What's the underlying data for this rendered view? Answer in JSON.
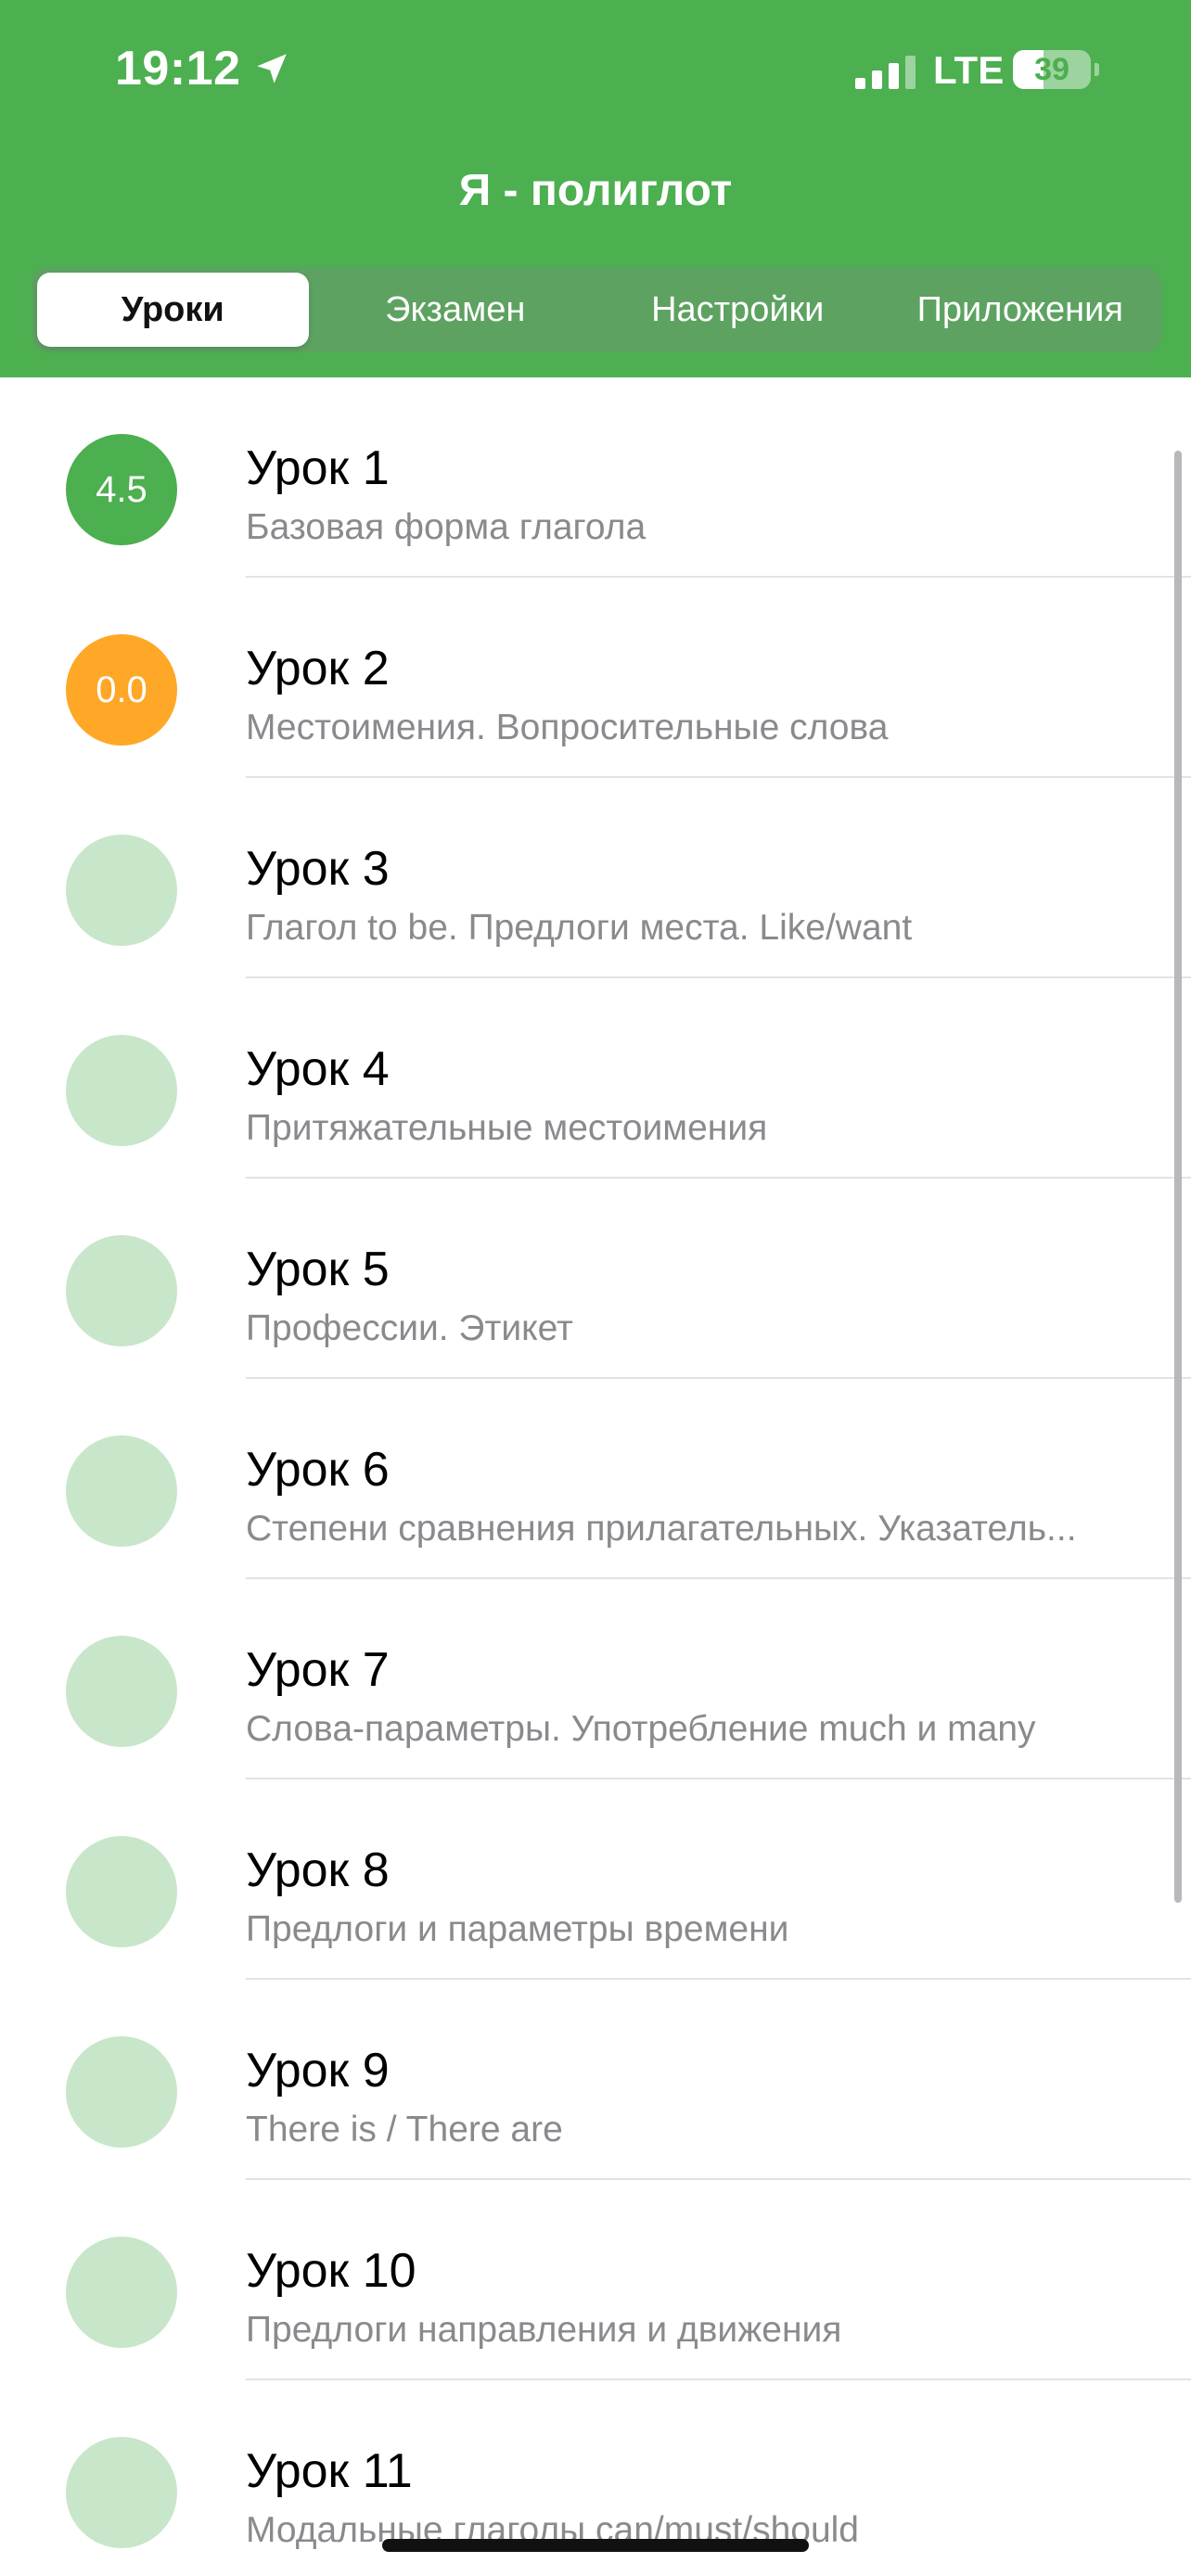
{
  "status_bar": {
    "time": "19:12",
    "network": "LTE",
    "battery_level": "39",
    "battery_fraction": 0.39,
    "signal_bars_active": 3
  },
  "app": {
    "title": "Я - полиглот"
  },
  "colors": {
    "header": "#4caf50",
    "score_good": "#4caf50",
    "score_warning": "#ffa726",
    "score_empty": "#c8e6c9"
  },
  "tabs": [
    {
      "label": "Уроки",
      "active": true
    },
    {
      "label": "Экзамен",
      "active": false
    },
    {
      "label": "Настройки",
      "active": false
    },
    {
      "label": "Приложения",
      "active": false
    }
  ],
  "lessons": [
    {
      "title": "Урок 1",
      "subtitle": "Базовая форма глагола",
      "score": "4.5",
      "status": "good"
    },
    {
      "title": "Урок 2",
      "subtitle": "Местоимения. Вопросительные слова",
      "score": "0.0",
      "status": "warning"
    },
    {
      "title": "Урок 3",
      "subtitle": "Глагол to be. Предлоги места. Like/want",
      "score": "",
      "status": "empty"
    },
    {
      "title": "Урок 4",
      "subtitle": "Притяжательные местоимения",
      "score": "",
      "status": "empty"
    },
    {
      "title": "Урок 5",
      "subtitle": "Профессии. Этикет",
      "score": "",
      "status": "empty"
    },
    {
      "title": "Урок 6",
      "subtitle": "Степени сравнения прилагательных. Указатель...",
      "score": "",
      "status": "empty"
    },
    {
      "title": "Урок 7",
      "subtitle": "Слова-параметры. Употребление much и many",
      "score": "",
      "status": "empty"
    },
    {
      "title": "Урок 8",
      "subtitle": "Предлоги и параметры времени",
      "score": "",
      "status": "empty"
    },
    {
      "title": "Урок 9",
      "subtitle": "There is / There are",
      "score": "",
      "status": "empty"
    },
    {
      "title": "Урок 10",
      "subtitle": "Предлоги направления и движения",
      "score": "",
      "status": "empty"
    },
    {
      "title": "Урок 11",
      "subtitle": "Модальные глаголы can/must/should",
      "score": "",
      "status": "empty"
    }
  ]
}
